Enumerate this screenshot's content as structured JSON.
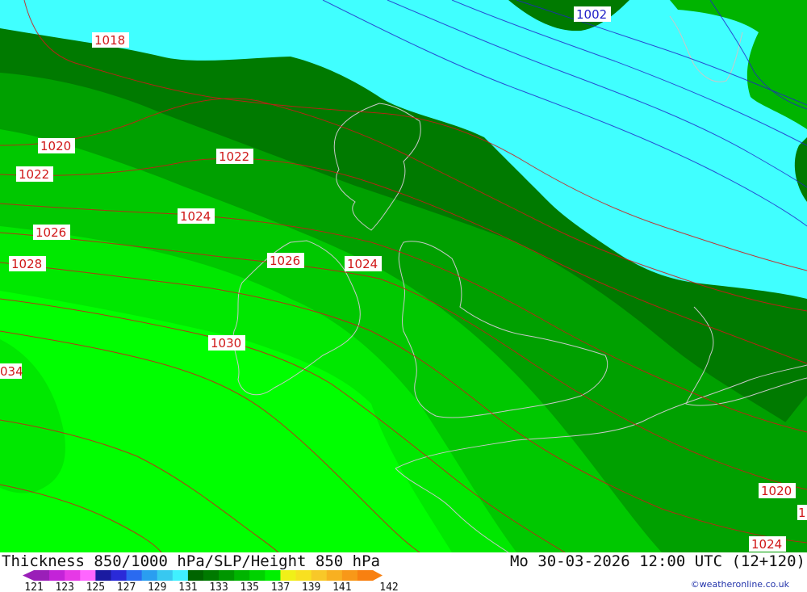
{
  "map": {
    "isobar_labels": [
      {
        "text": "1018",
        "color": "red"
      },
      {
        "text": "1020",
        "color": "red"
      },
      {
        "text": "1022",
        "color": "red"
      },
      {
        "text": "1022",
        "color": "red"
      },
      {
        "text": "1024",
        "color": "red"
      },
      {
        "text": "1026",
        "color": "red"
      },
      {
        "text": "1028",
        "color": "red"
      },
      {
        "text": "1026",
        "color": "red"
      },
      {
        "text": "1024",
        "color": "red"
      },
      {
        "text": "1030",
        "color": "red"
      },
      {
        "text": "034",
        "color": "red"
      },
      {
        "text": "1002",
        "color": "blue"
      },
      {
        "text": "1020",
        "color": "red"
      },
      {
        "text": "1024",
        "color": "red"
      },
      {
        "text": "1",
        "color": "red"
      }
    ],
    "colors": {
      "cyan": "#40ffff",
      "dark_green": "#007a00",
      "green_mid": "#00a000",
      "green_light": "#00c800",
      "bright_green": "#00e800",
      "lime": "#00ff00",
      "isobar_red": "#d01818",
      "isobar_blue": "#2222c8",
      "coast": "#c8c8c8"
    }
  },
  "footer": {
    "title": "Thickness 850/1000 hPa/SLP/Height 850 hPa",
    "datetime": "Mo 30-03-2026 12:00 UTC (12+120)",
    "credit": "©weatheronline.co.uk"
  },
  "legend": {
    "ticks": [
      "121",
      "123",
      "125",
      "127",
      "129",
      "131",
      "133",
      "135",
      "137",
      "139",
      "141",
      "142"
    ],
    "colors": [
      "#9a1fb8",
      "#c323d8",
      "#e639e6",
      "#ff66ff",
      "#1a1aa0",
      "#2a2ad8",
      "#2a6af0",
      "#2a9ef0",
      "#38c8f0",
      "#40f0ff",
      "#006400",
      "#007a00",
      "#009600",
      "#00b400",
      "#00d200",
      "#00f000",
      "#f0f018",
      "#f8e020",
      "#f8c828",
      "#f8b020",
      "#f89818",
      "#f88010"
    ]
  }
}
